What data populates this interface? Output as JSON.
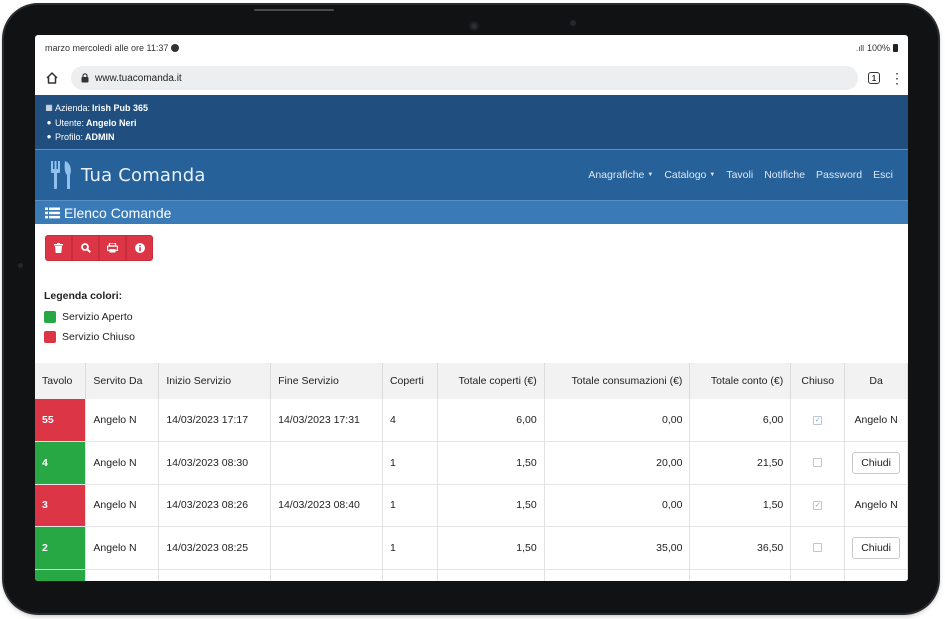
{
  "status_bar": {
    "time_text": "marzo mercoledì alle ore 11:37",
    "battery": "100%"
  },
  "browser": {
    "url": "www.tuacomanda.it",
    "tab_count": "1"
  },
  "info": {
    "azienda_label": "Azienda:",
    "azienda_value": "Irish Pub 365",
    "utente_label": "Utente:",
    "utente_value": "Angelo Neri",
    "profilo_label": "Profilo:",
    "profilo_value": "ADMIN"
  },
  "nav": {
    "brand": "Tua Comanda",
    "links": [
      "Anagrafiche",
      "Catalogo",
      "Tavoli",
      "Notifiche",
      "Password",
      "Esci"
    ]
  },
  "page": {
    "title": "Elenco Comande"
  },
  "legend": {
    "title": "Legenda colori:",
    "open_label": "Servizio Aperto",
    "closed_label": "Servizio Chiuso",
    "open_color": "#28a745",
    "closed_color": "#dc3545"
  },
  "table": {
    "headers": [
      "Tavolo",
      "Servito Da",
      "Inizio Servizio",
      "Fine Servizio",
      "Coperti",
      "Totale coperti (€)",
      "Totale consumazioni (€)",
      "Totale conto (€)",
      "Chiuso",
      "Da"
    ],
    "rows": [
      {
        "tavolo": "55",
        "servito_da": "Angelo N",
        "inizio": "14/03/2023 17:17",
        "fine": "14/03/2023 17:31",
        "coperti": "4",
        "tot_coperti": "6,00",
        "tot_consumazioni": "0,00",
        "tot_conto": "6,00",
        "da": "Angelo N"
      },
      {
        "tavolo": "4",
        "servito_da": "Angelo N",
        "inizio": "14/03/2023 08:30",
        "fine": "",
        "coperti": "1",
        "tot_coperti": "1,50",
        "tot_consumazioni": "20,00",
        "tot_conto": "21,50",
        "da": "Chiudi"
      },
      {
        "tavolo": "3",
        "servito_da": "Angelo N",
        "inizio": "14/03/2023 08:26",
        "fine": "14/03/2023 08:40",
        "coperti": "1",
        "tot_coperti": "1,50",
        "tot_consumazioni": "0,00",
        "tot_conto": "1,50",
        "da": "Angelo N"
      },
      {
        "tavolo": "2",
        "servito_da": "Angelo N",
        "inizio": "14/03/2023 08:25",
        "fine": "",
        "coperti": "1",
        "tot_coperti": "1,50",
        "tot_consumazioni": "35,00",
        "tot_conto": "36,50",
        "da": "Chiudi"
      }
    ]
  },
  "colors": {
    "info_bar": "#1f4e7f",
    "nav_bar": "#27619a",
    "section_bar": "#3a7ab7",
    "danger": "#dc3545",
    "success": "#28a745"
  }
}
